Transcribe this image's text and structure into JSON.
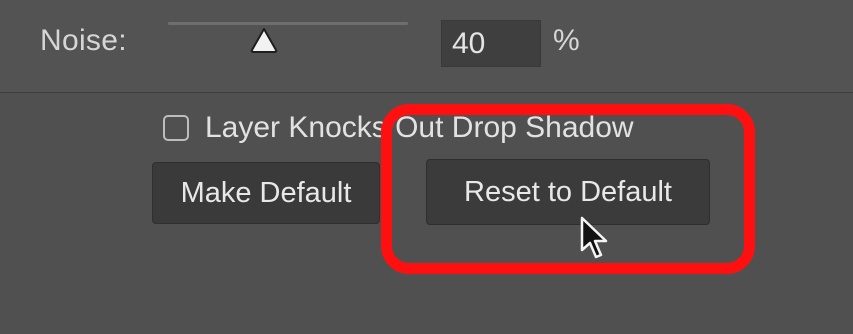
{
  "noise": {
    "label": "Noise:",
    "value": "40",
    "unit": "%",
    "slider_level_percent": 40
  },
  "options": {
    "layer_knocks_out_label": "Layer Knocks Out Drop Shadow",
    "layer_knocks_out_checked": false
  },
  "buttons": {
    "make_default_label": "Make Default",
    "reset_to_default_label": "Reset to Default"
  },
  "annotation": {
    "highlight_color": "#ff1010"
  },
  "icons": {
    "slider_thumb": "triangle-thumb-icon",
    "cursor": "arrow-cursor-icon"
  }
}
